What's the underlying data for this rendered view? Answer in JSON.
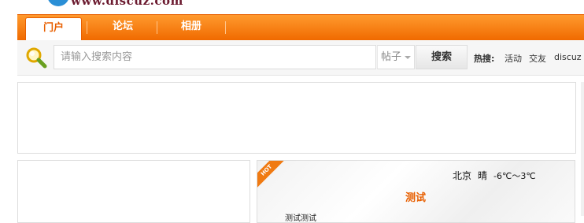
{
  "logo": {
    "text": "www.discuz.com"
  },
  "nav": {
    "tabs": [
      {
        "label": "门户",
        "active": true
      },
      {
        "label": "论坛",
        "active": false
      },
      {
        "label": "相册",
        "active": false
      }
    ],
    "accent_color": "#f07a12"
  },
  "search": {
    "placeholder": "请输入搜索内容",
    "type_selected": "帖子",
    "button_label": "搜索",
    "hot_label": "热搜:",
    "hot_links": [
      "活动",
      "交友",
      "discuz"
    ]
  },
  "featured": {
    "ribbon": "HOT",
    "weather_city": "北京",
    "weather_condition": "晴",
    "weather_temp": "-6℃～3℃",
    "title": "测试",
    "text": "测试测试"
  }
}
